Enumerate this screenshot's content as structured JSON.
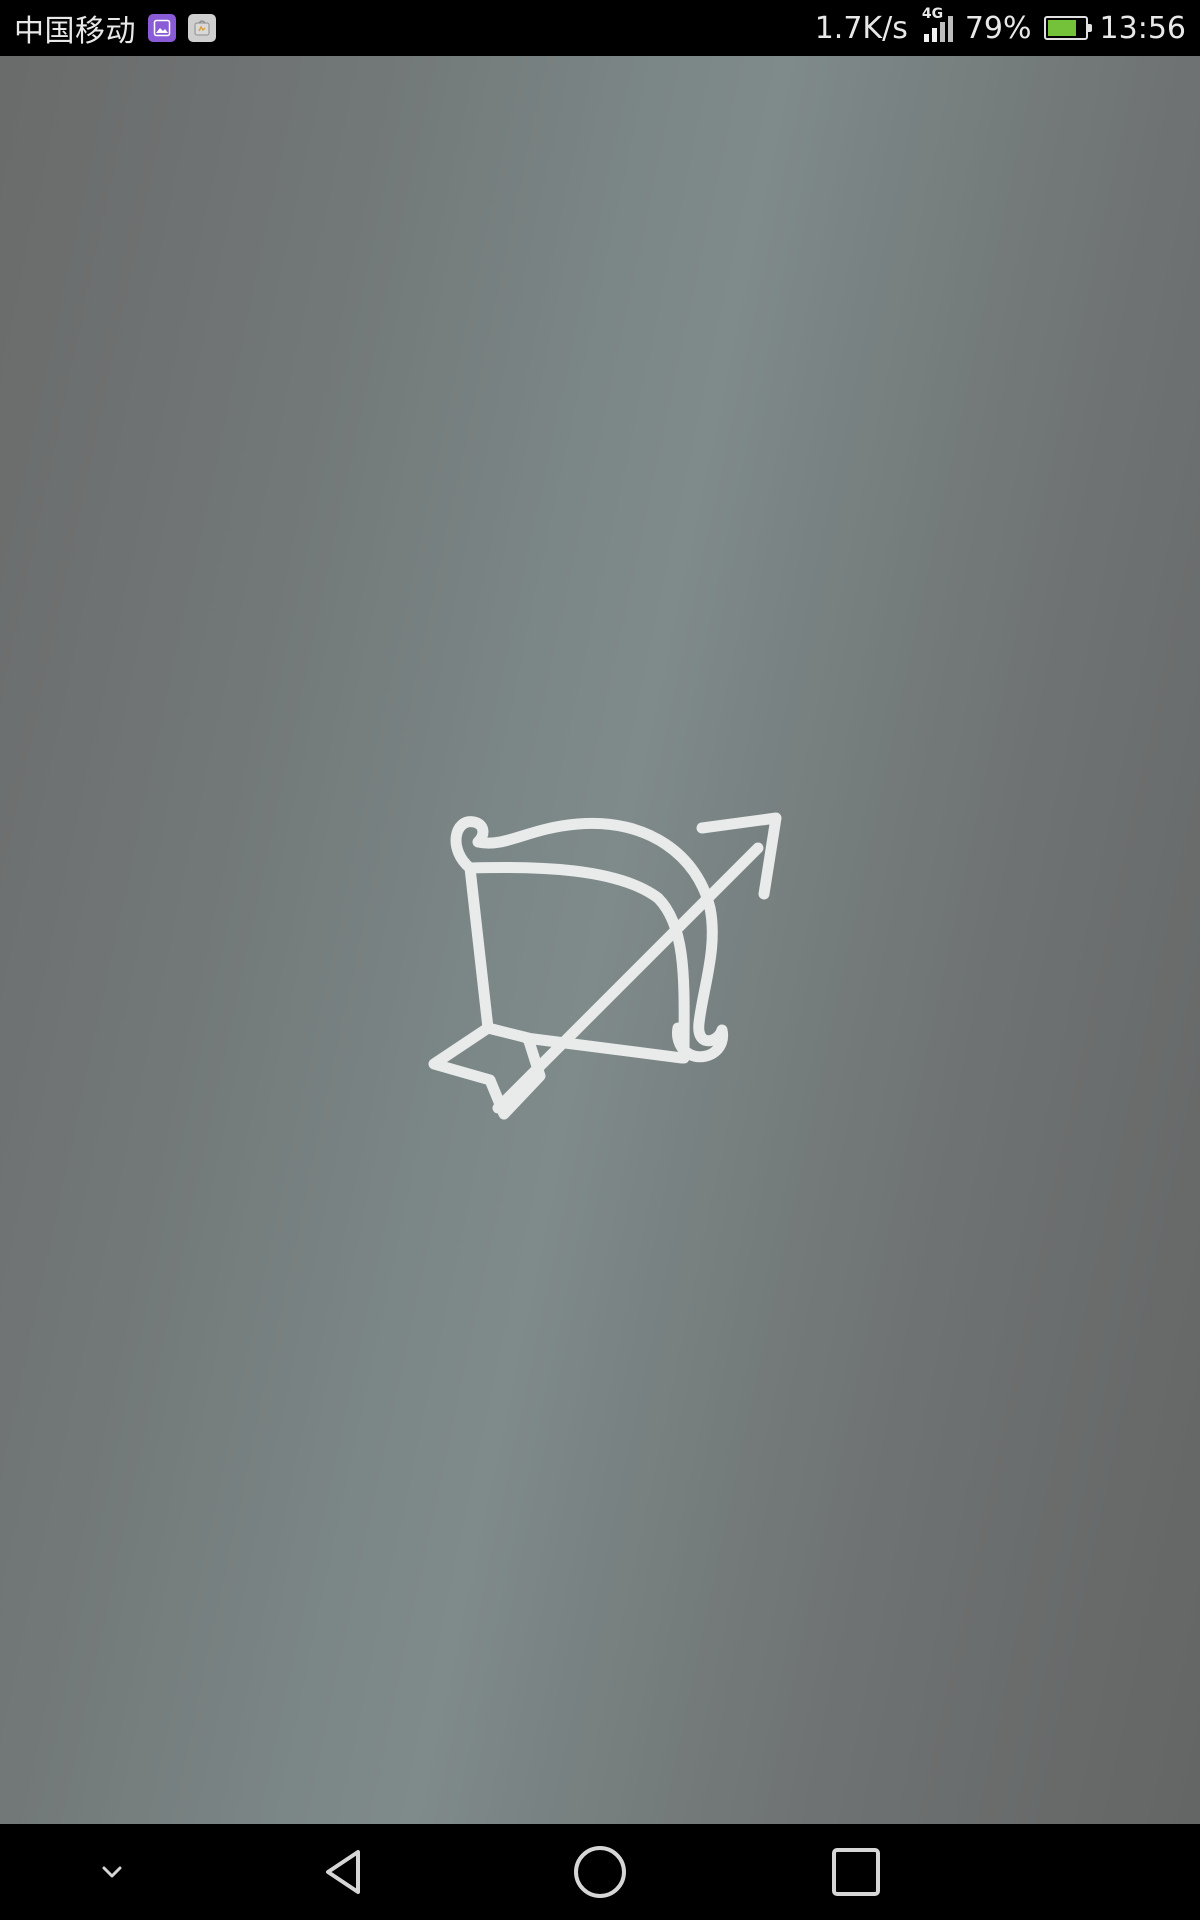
{
  "status_bar": {
    "carrier": "中国移动",
    "notifications": [
      "gallery-icon",
      "app-store-icon"
    ],
    "net_speed": "1.7K/s",
    "network_type": "4G",
    "signal_bars_on": 2,
    "signal_bars_total": 4,
    "battery_percent": "79%",
    "battery_level": 0.79,
    "battery_charging": true,
    "time": "13:56"
  },
  "content": {
    "logo": "bow-and-arrow-icon",
    "background_colors": [
      "#6a6b6b",
      "#7f8a8a",
      "#646565"
    ]
  },
  "nav_bar": {
    "buttons": [
      "chevron-down-icon",
      "back-icon",
      "home-icon",
      "recents-icon"
    ]
  }
}
